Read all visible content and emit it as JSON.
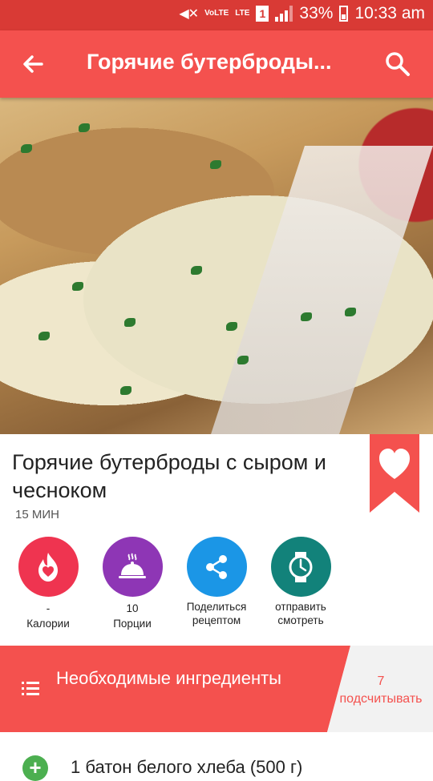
{
  "status_bar": {
    "battery": "33%",
    "time": "10:33 am",
    "network": "LTE",
    "volte": "VoLTE",
    "sim": "1"
  },
  "app_bar": {
    "title": "Горячие бутерброды..."
  },
  "recipe": {
    "title": "Горячие бутерброды с сыром и чесноком",
    "time": "15 МИН"
  },
  "actions": [
    {
      "value": "-",
      "label": "Калории",
      "color": "#ef3450",
      "icon": "calories-icon"
    },
    {
      "value": "10",
      "label": "Порции",
      "color": "#8e36b5",
      "icon": "serving-dish-icon"
    },
    {
      "value": "",
      "label": "Поделиться рецептом",
      "color": "#1b96e6",
      "icon": "share-icon"
    },
    {
      "value": "",
      "label": "отправить смотреть",
      "color": "#12827a",
      "icon": "watch-icon"
    }
  ],
  "ingredients_header": {
    "label": "Необходимые ингредиенты",
    "count": "7",
    "count_label": "подсчитывать"
  },
  "ingredients": [
    {
      "text": "1 батон белого хлеба (500 г)"
    }
  ],
  "colors": {
    "primary": "#f4514e",
    "status_bar": "#d93a35",
    "add": "#4caf50"
  }
}
